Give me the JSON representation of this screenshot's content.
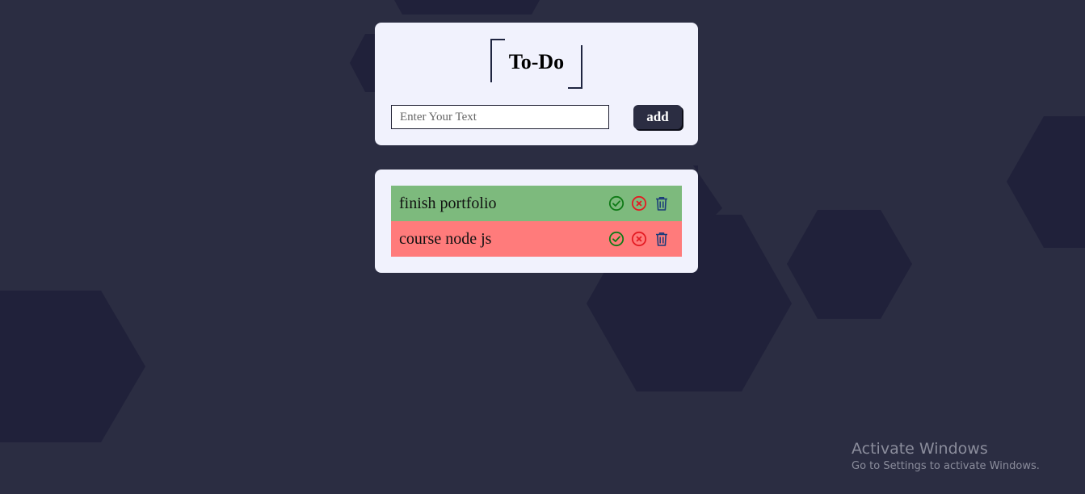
{
  "app": {
    "title": "To-Do"
  },
  "input": {
    "placeholder": "Enter Your Text",
    "value": ""
  },
  "add_button": {
    "label": "add"
  },
  "todos": [
    {
      "text": "finish portfolio",
      "status": "completed",
      "background": "#7dba7d"
    },
    {
      "text": "course node js",
      "status": "cancelled",
      "background": "#ff7b7b"
    }
  ],
  "icons": {
    "complete": "check-circle-icon",
    "cancel": "x-circle-icon",
    "delete": "trash-icon"
  },
  "colors": {
    "background": "#2b2d42",
    "hexagon": "#20213a",
    "card": "#f1f2fd",
    "complete_icon": "#0f7a16",
    "cancel_icon": "#e41b23",
    "delete_icon": "#1b3b7a"
  },
  "watermark": {
    "line1": "Activate Windows",
    "line2": "Go to Settings to activate Windows."
  }
}
